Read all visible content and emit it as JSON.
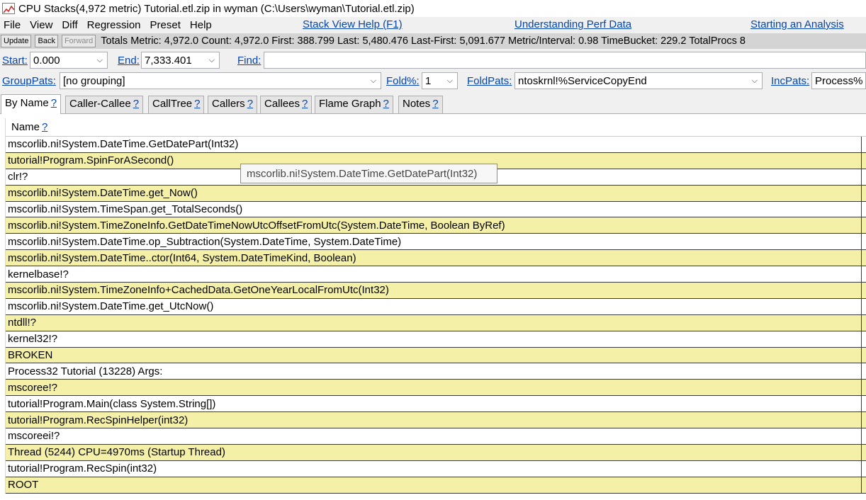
{
  "window": {
    "title": "CPU Stacks(4,972 metric) Tutorial.etl.zip in wyman (C:\\Users\\wyman\\Tutorial.etl.zip)"
  },
  "menu": {
    "items": [
      "File",
      "View",
      "Diff",
      "Regression",
      "Preset",
      "Help"
    ],
    "links": [
      "Stack View Help (F1)",
      "Understanding Perf Data",
      "Starting an Analysis"
    ]
  },
  "toolbar": {
    "update_label": "Update",
    "back_label": "Back",
    "forward_label": "Forward",
    "totals": "Totals Metric: 4,972.0  Count: 4,972.0  First: 388.799 Last: 5,480.476  Last-First: 5,091.677  Metric/Interval: 0.98  TimeBucket: 229.2  TotalProcs 8"
  },
  "range": {
    "start_label": "Start:",
    "start_value": "0.000",
    "end_label": "End:",
    "end_value": "7,333.401",
    "find_label": "Find:",
    "find_value": ""
  },
  "grouping": {
    "grouppats_label": "GroupPats:",
    "grouppats_value": "[no grouping]",
    "fold_label": "Fold%:",
    "fold_value": "1",
    "foldpats_label": "FoldPats:",
    "foldpats_value": "ntoskrnl!%ServiceCopyEnd",
    "incpats_label": "IncPats:",
    "incpats_value": "Process%"
  },
  "tabs": [
    {
      "label": "By Name",
      "help": "?"
    },
    {
      "label": "Caller-Callee",
      "help": "?"
    },
    {
      "label": "CallTree",
      "help": "?"
    },
    {
      "label": "Callers",
      "help": "?"
    },
    {
      "label": "Callees",
      "help": "?"
    },
    {
      "label": "Flame Graph",
      "help": "?"
    },
    {
      "label": "Notes",
      "help": "?"
    }
  ],
  "grid": {
    "column_header": "Name",
    "column_help": "?",
    "rows": [
      "mscorlib.ni!System.DateTime.GetDatePart(Int32)",
      "tutorial!Program.SpinForASecond()",
      "clr!?",
      "mscorlib.ni!System.DateTime.get_Now()",
      "mscorlib.ni!System.TimeSpan.get_TotalSeconds()",
      "mscorlib.ni!System.TimeZoneInfo.GetDateTimeNowUtcOffsetFromUtc(System.DateTime, Boolean ByRef)",
      "mscorlib.ni!System.DateTime.op_Subtraction(System.DateTime, System.DateTime)",
      "mscorlib.ni!System.DateTime..ctor(Int64, System.DateTimeKind, Boolean)",
      "kernelbase!?",
      "mscorlib.ni!System.TimeZoneInfo+CachedData.GetOneYearLocalFromUtc(Int32)",
      "mscorlib.ni!System.DateTime.get_UtcNow()",
      "ntdll!?",
      "kernel32!?",
      "BROKEN",
      "Process32 Tutorial (13228) Args: ",
      "mscoree!?",
      "tutorial!Program.Main(class System.String[])",
      "tutorial!Program.RecSpinHelper(int32)",
      "mscoreei!?",
      "Thread (5244) CPU=4970ms (Startup Thread)",
      "tutorial!Program.RecSpin(int32)",
      "ROOT"
    ]
  },
  "tooltip": {
    "text": "mscorlib.ni!System.DateTime.GetDatePart(Int32)"
  },
  "colors": {
    "link": "#0645ad",
    "row_highlight": "#f5f0a8",
    "totals_bg": "#d4d4d4"
  }
}
